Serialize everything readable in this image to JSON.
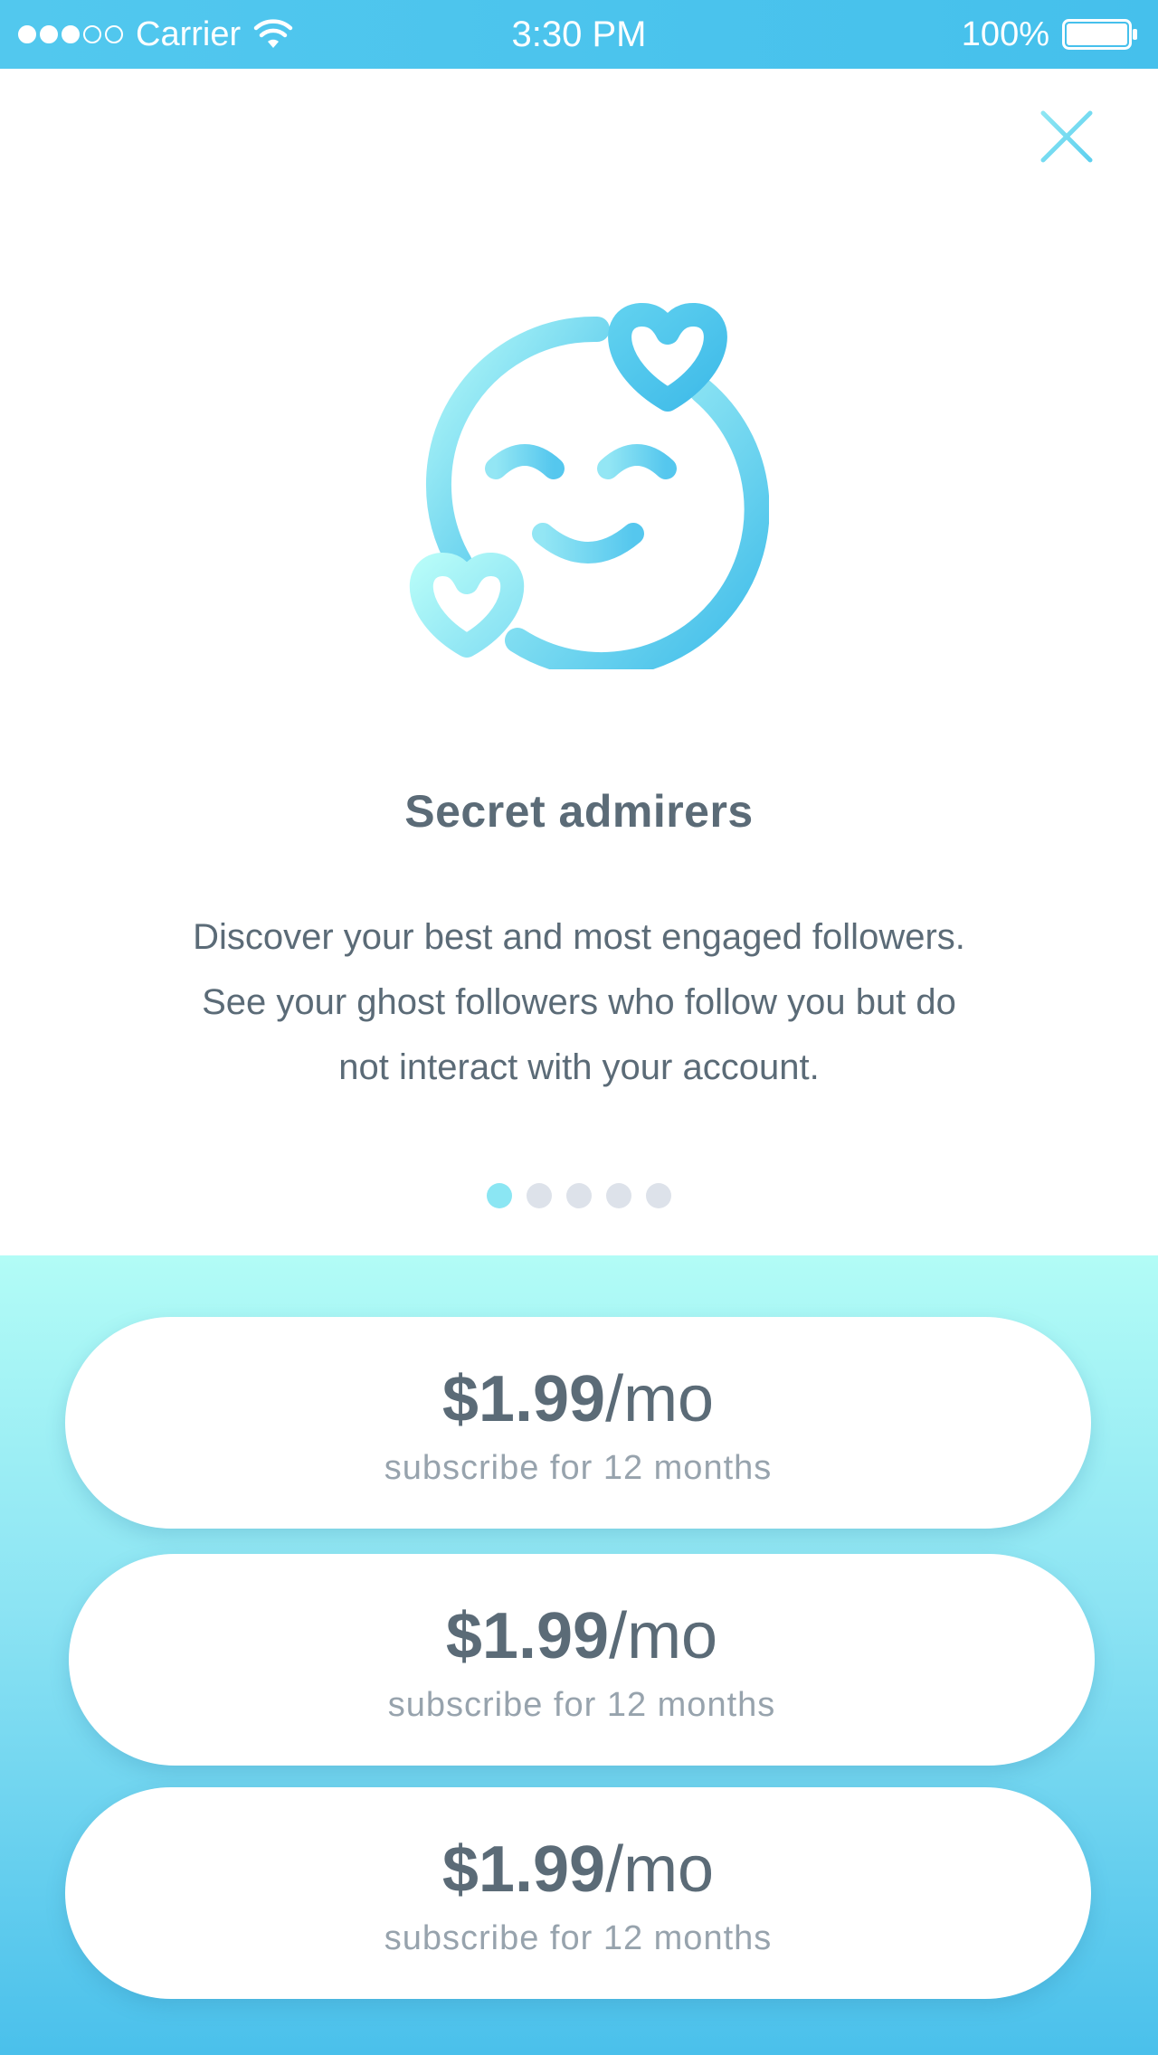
{
  "status_bar": {
    "carrier": "Carrier",
    "time": "3:30 PM",
    "battery": "100%",
    "signal_strength": 3
  },
  "icons": {
    "close": "close-icon",
    "hero": "smiling-face-with-hearts-icon",
    "wifi": "wifi-icon",
    "battery": "battery-icon"
  },
  "feature": {
    "title": "Secret admirers",
    "description_lines": [
      "Discover your best and most engaged followers.",
      "See your ghost followers who follow you but do",
      "not interact with your account."
    ]
  },
  "pager": {
    "total": 5,
    "active_index": 0
  },
  "plans": [
    {
      "price": "$1.99",
      "unit": "/mo",
      "subtitle": "subscribe for 12 months"
    },
    {
      "price": "$1.99",
      "unit": "/mo",
      "subtitle": "subscribe for 12 months"
    },
    {
      "price": "$1.99",
      "unit": "/mo",
      "subtitle": "subscribe for 12 months"
    }
  ],
  "colors": {
    "status_bar": "#4ac2ec",
    "text_primary": "#5b6b77",
    "text_secondary": "#97a3ad",
    "accent_light": "#b2fcf6",
    "accent_dark": "#4ac0eb",
    "pager_active": "#8be6f3",
    "pager_inactive": "#dde2ea"
  }
}
